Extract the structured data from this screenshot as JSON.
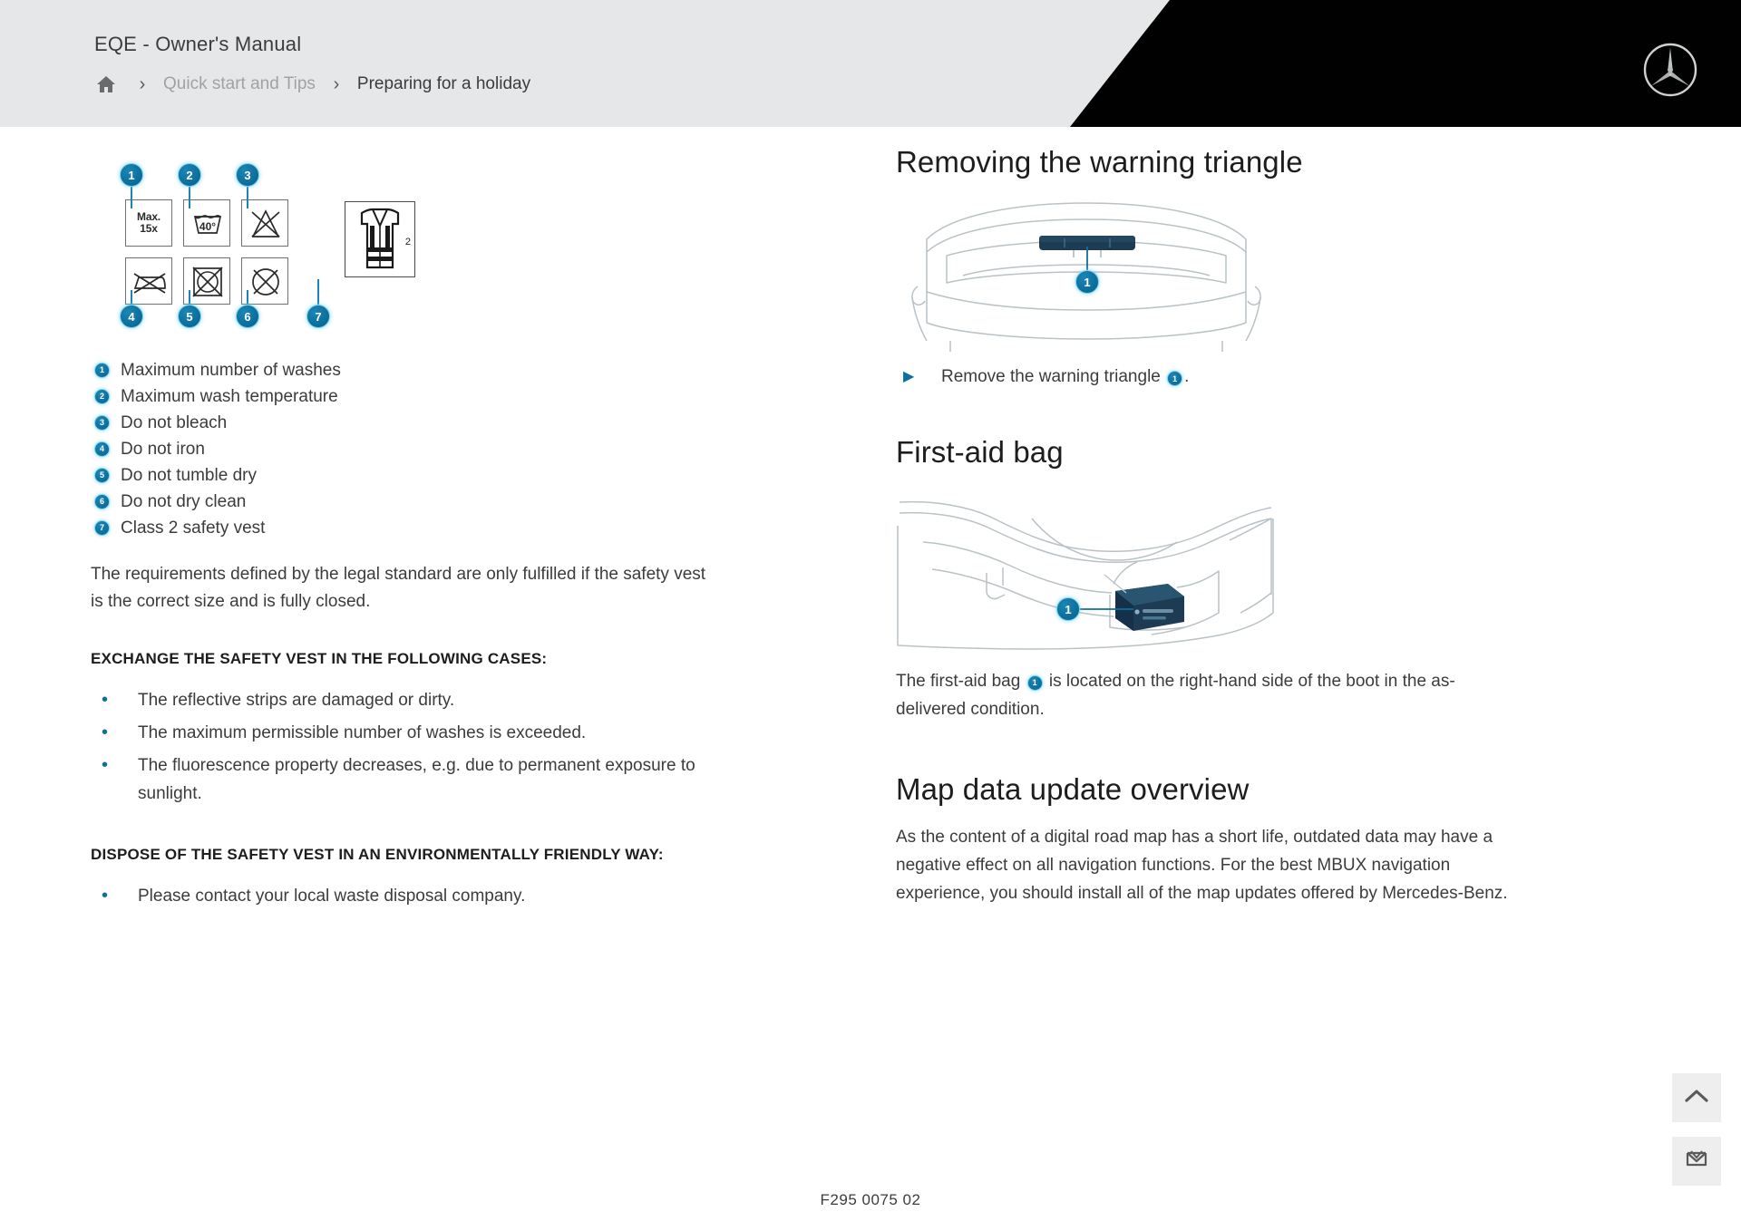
{
  "header": {
    "title": "EQE - Owner's Manual",
    "breadcrumb": {
      "home_icon": "home-icon",
      "separator": "›",
      "parent": "Quick start and Tips",
      "current": "Preparing for a holiday"
    },
    "logo_name": "mercedes-benz-star-logo"
  },
  "left": {
    "figure": {
      "symbols": [
        {
          "num": "1",
          "kind": "max-washes",
          "line1": "Max.",
          "line2": "15x"
        },
        {
          "num": "2",
          "kind": "wash-40",
          "label": "40°"
        },
        {
          "num": "3",
          "kind": "no-bleach"
        },
        {
          "num": "4",
          "kind": "no-iron"
        },
        {
          "num": "5",
          "kind": "no-tumble-dry"
        },
        {
          "num": "6",
          "kind": "no-dry-clean"
        },
        {
          "num": "7",
          "kind": "safety-vest",
          "label": "2"
        }
      ]
    },
    "legend": [
      {
        "num": "1",
        "text": "Maximum number of washes"
      },
      {
        "num": "2",
        "text": "Maximum wash temperature"
      },
      {
        "num": "3",
        "text": "Do not bleach"
      },
      {
        "num": "4",
        "text": "Do not iron"
      },
      {
        "num": "5",
        "text": "Do not tumble dry"
      },
      {
        "num": "6",
        "text": "Do not dry clean"
      },
      {
        "num": "7",
        "text": "Class 2 safety vest"
      }
    ],
    "paragraph": "The requirements defined by the legal standard are only fulfilled if the safety vest is the correct size and is fully closed.",
    "exchange_heading": "EXCHANGE THE SAFETY VEST IN THE FOLLOWING CASES:",
    "exchange_bullets": [
      "The reflective strips are damaged or dirty.",
      "The maximum permissible number of washes is exceeded.",
      "The fluorescence property decreases, e.g. due to permanent exposure to sunlight."
    ],
    "dispose_heading": "DISPOSE OF THE SAFETY VEST IN AN ENVIRONMENTALLY FRIENDLY WAY:",
    "dispose_bullets": [
      "Please contact your local waste disposal company."
    ]
  },
  "right": {
    "heading_warning_triangle": "Removing the warning triangle",
    "warning_callout": "1",
    "step_prefix": "Remove the warning triangle",
    "step_badge": "1",
    "step_suffix": ".",
    "heading_first_aid": "First-aid bag",
    "first_aid_callout": "1",
    "first_aid_text_before": "The first-aid bag",
    "first_aid_badge": "1",
    "first_aid_text_after": "is located on the right-hand side of the boot in the as-delivered condition.",
    "heading_map": "Map data update overview",
    "map_paragraph": "As the content of a digital road map has a short life, outdated data may have a negative effect on all navigation functions. For the best MBUX navigation experience, you should install all of the map updates offered by Mercedes-Benz."
  },
  "footer": {
    "code": "F295 0075 02"
  },
  "fabs": [
    {
      "name": "scroll-to-top-button",
      "icon": "chevron-up-icon"
    },
    {
      "name": "feedback-button",
      "icon": "feedback-icon"
    }
  ],
  "colors": {
    "accent": "#0d6f9e",
    "accent_glow": "#7ed4ef",
    "header_bg": "#e6e7e8",
    "header_black": "#010101",
    "text": "#3c3c3c",
    "heading": "#1d1d1d",
    "line": "#9aa3a8"
  }
}
